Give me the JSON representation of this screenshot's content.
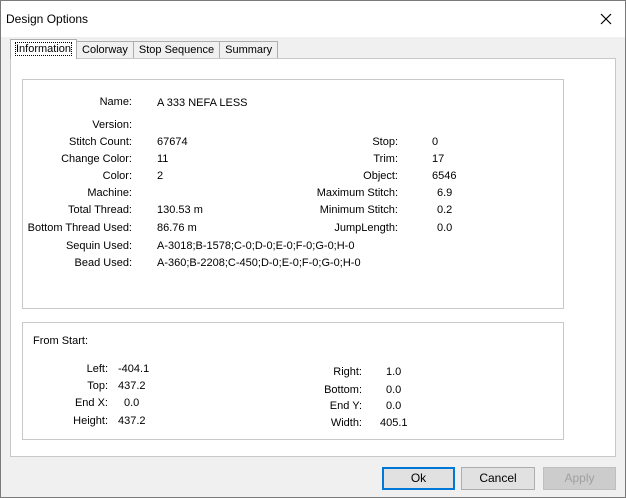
{
  "window": {
    "title": "Design Options",
    "close_glyph": "✕"
  },
  "tabs": [
    {
      "label": "Information",
      "active": true
    },
    {
      "label": "Colorway",
      "active": false
    },
    {
      "label": "Stop Sequence",
      "active": false
    },
    {
      "label": "Summary",
      "active": false
    }
  ],
  "info": {
    "name_label": "Name:",
    "name_value": "A 333 NEFA LESS",
    "version_label": "Version:",
    "version_value": "",
    "stitch_count_label": "Stitch Count:",
    "stitch_count_value": "67674",
    "change_color_label": "Change Color:",
    "change_color_value": "11",
    "color_label": "Color:",
    "color_value": "2",
    "machine_label": "Machine:",
    "machine_value": "",
    "total_thread_label": "Total Thread:",
    "total_thread_value": "130.53 m",
    "bottom_thread_label": "Bottom Thread Used:",
    "bottom_thread_value": "86.76 m",
    "sequin_label": "Sequin Used:",
    "sequin_value": "A-3018;B-1578;C-0;D-0;E-0;F-0;G-0;H-0",
    "bead_label": "Bead Used:",
    "bead_value": "A-360;B-2208;C-450;D-0;E-0;F-0;G-0;H-0",
    "stop_label": "Stop:",
    "stop_value": "0",
    "trim_label": "Trim:",
    "trim_value": "17",
    "object_label": "Object:",
    "object_value": "6546",
    "max_stitch_label": "Maximum Stitch:",
    "max_stitch_value": "6.9",
    "min_stitch_label": "Minimum Stitch:",
    "min_stitch_value": "0.2",
    "jump_length_label": "JumpLength:",
    "jump_length_value": "0.0"
  },
  "from_start": {
    "title": "From Start:",
    "left_label": "Left:",
    "left_value": "-404.1",
    "top_label": "Top:",
    "top_value": "437.2",
    "end_x_label": "End X:",
    "end_x_value": "0.0",
    "height_label": "Height:",
    "height_value": "437.2",
    "right_label": "Right:",
    "right_value": "1.0",
    "bottom_label": "Bottom:",
    "bottom_value": "0.0",
    "end_y_label": "End Y:",
    "end_y_value": "0.0",
    "width_label": "Width:",
    "width_value": "405.1"
  },
  "buttons": {
    "ok": "Ok",
    "cancel": "Cancel",
    "apply": "Apply"
  }
}
